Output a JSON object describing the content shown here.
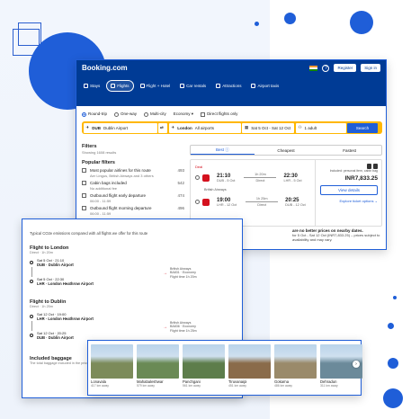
{
  "colors": {
    "brand": "#003b95",
    "accent": "#1f5ed8",
    "search_border": "#ffb700",
    "deal_red": "#d4111e"
  },
  "header": {
    "logo": "Booking.com",
    "sign_in": "Sign in",
    "register": "Register",
    "help_icon": "?",
    "nav": [
      {
        "label": "Stays",
        "icon": "bed-icon"
      },
      {
        "label": "Flights",
        "icon": "plane-icon",
        "active": true
      },
      {
        "label": "Flight + Hotel",
        "icon": "plane-hotel-icon"
      },
      {
        "label": "Car rentals",
        "icon": "car-icon"
      },
      {
        "label": "Attractions",
        "icon": "attractions-icon"
      },
      {
        "label": "Airport taxis",
        "icon": "taxi-icon"
      }
    ]
  },
  "trip_options": {
    "round_trip": "Round-trip",
    "one_way": "One-way",
    "multi_city": "Multi-city",
    "cabin_class": "Economy",
    "direct_only": "Direct flights only"
  },
  "search": {
    "from_code": "DUB",
    "from_name": "Dublin Airport",
    "to_code": "London",
    "to_name": "All airports",
    "dates": "Sat 5 Oct - Sat 12 Oct",
    "travellers": "1 adult",
    "button": "Search"
  },
  "filters": {
    "title": "Filters",
    "showing": "Showing 1608 results",
    "popular_title": "Popular filters",
    "items": [
      {
        "label": "Most popular airlines for this route",
        "sub": "Aer Lingus, British Airways and 3 others",
        "count": "493"
      },
      {
        "label": "Cabin bags included",
        "sub": "No additional fee",
        "count": "542"
      },
      {
        "label": "Outbound flight early departure",
        "sub": "06:00 - 11:59",
        "count": "474"
      },
      {
        "label": "Outbound flight morning departure",
        "sub": "06:00 - 11:59",
        "count": "496"
      }
    ]
  },
  "sort_tabs": [
    {
      "label": "Best",
      "active": true
    },
    {
      "label": "Cheapest"
    },
    {
      "label": "Fastest"
    }
  ],
  "result": {
    "deal_label": "Deal",
    "legs": [
      {
        "dep_time": "21:10",
        "dep_code": "DUB - 5 Oct",
        "duration": "1h 20m",
        "stops": "Direct",
        "arr_time": "22:30",
        "arr_code": "LHR - 5 Oct"
      },
      {
        "dep_time": "19:00",
        "dep_code": "LHR - 12 Oct",
        "duration": "1h 25m",
        "stops": "Direct",
        "arr_time": "20:25",
        "arr_code": "DUB - 12 Oct"
      }
    ],
    "airline": "British Airways",
    "bags_note": "Included: personal item, cabin bag",
    "price": "INR7,833.25",
    "view_details": "View details",
    "explore": "Explore ticket options"
  },
  "banner": {
    "title": "are no better prices on nearby dates.",
    "sub": "for 5 Oct - Sat 12 Oct (INR7,833.25) – prices subject to availability and may vary."
  },
  "emissions": {
    "intro": "Typical CO2e emissions compared with all flights we offer for this route",
    "outbound": {
      "title": "Flight to London",
      "sub": "Direct · 1h 20m",
      "dep": "Sat 5 Oct · 21:10",
      "dep_airport": "DUB · Dublin Airport",
      "arr": "Sat 5 Oct · 22:30",
      "arr_airport": "LHR · London Heathrow Airport",
      "operator": "British Airways",
      "flight_no": "BA831 · Economy",
      "flight_time": "Flight time 1h 20m"
    },
    "inbound": {
      "title": "Flight to Dublin",
      "sub": "Direct · 1h 25m",
      "dep": "Sat 12 Oct · 19:00",
      "dep_airport": "LHR · London Heathrow Airport",
      "arr": "Sat 12 Oct · 20:25",
      "arr_airport": "DUB · Dublin Airport",
      "operator": "British Airways",
      "flight_no": "BA836 · Economy",
      "flight_time": "Flight time 1h 25m"
    },
    "baggage_title": "Included baggage",
    "baggage_sub": "The total baggage included in the price"
  },
  "destinations": [
    {
      "name": "Lonavala",
      "distance": "417 km away",
      "color": "#7c8b5a"
    },
    {
      "name": "Mahabaleshwar",
      "distance": "579 km away",
      "color": "#6a8a55"
    },
    {
      "name": "Panchgani",
      "distance": "561 km away",
      "color": "#5d7d4b"
    },
    {
      "name": "Tiruvanaipi",
      "distance": "451 km away",
      "color": "#8a6b4a"
    },
    {
      "name": "Gokarna",
      "distance": "486 km away",
      "color": "#9a8a6a"
    },
    {
      "name": "Dehradun",
      "distance": "311 km away",
      "color": "#6b8a9a"
    }
  ]
}
